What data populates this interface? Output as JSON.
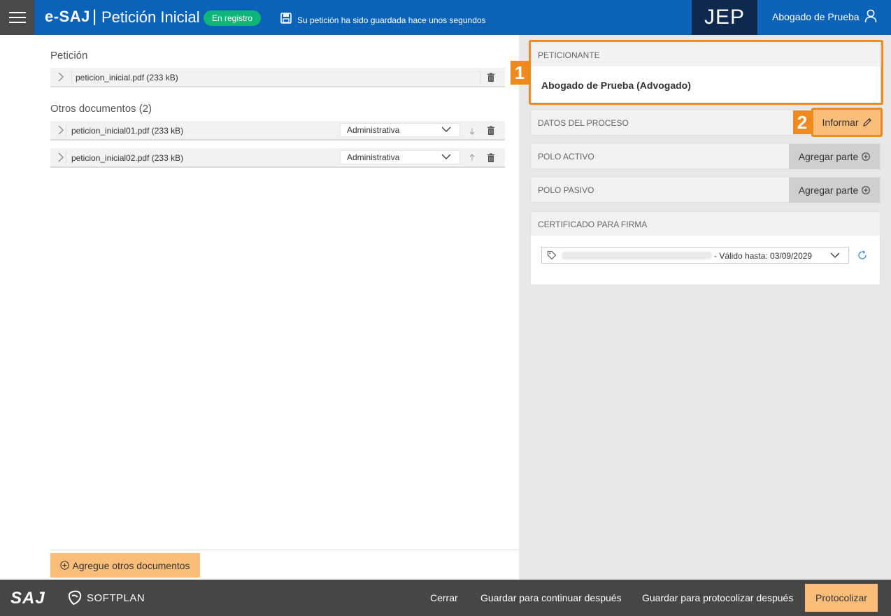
{
  "header": {
    "logo": "e-SAJ",
    "separator": "|",
    "title": "Petición Inicial",
    "status_badge": "En registro",
    "save_message": "Su petición ha sido guardada hace unos segundos",
    "court": "JEP",
    "user_name": "Abogado de Prueba",
    "colors": {
      "header_bg": "#0a63b8",
      "badge": "#10b578",
      "court_bg": "#0d2a4e"
    }
  },
  "left": {
    "peticion_label": "Petición",
    "main_doc": {
      "name": "peticion_inicial.pdf (233 kB)"
    },
    "otros_label": "Otros documentos (2)",
    "other_docs": [
      {
        "name": "peticion_inicial01.pdf (233 kB)",
        "type": "Administrativa",
        "move_icon": "arrow-down-icon"
      },
      {
        "name": "peticion_inicial02.pdf (233 kB)",
        "type": "Administrativa",
        "move_icon": "arrow-up-icon"
      }
    ],
    "add_button": "Agregue otros documentos"
  },
  "right": {
    "peticionante": {
      "title": "PETICIONANTE",
      "value": "Abogado de Prueba (Advogado)"
    },
    "datos": {
      "title": "DATOS DEL PROCESO",
      "button": "Informar"
    },
    "polo_activo": {
      "title": "POLO ACTIVO",
      "button": "Agregar parte"
    },
    "polo_pasivo": {
      "title": "POLO PASIVO",
      "button": "Agregar parte"
    },
    "certificado": {
      "title": "CERTIFICADO PARA FIRMA",
      "valid_text": "- Válido hasta: 03/09/2029"
    },
    "callouts": [
      "1",
      "2"
    ]
  },
  "footer": {
    "saj_logo": "SAJ",
    "softplan_logo": "SOFTPLAN",
    "cerrar": "Cerrar",
    "guardar_continuar": "Guardar para continuar después",
    "guardar_protocolizar": "Guardar para protocolizar después",
    "protocolizar": "Protocolizar",
    "colors": {
      "footer_bg": "#484545",
      "accent": "#fbbd7a",
      "highlight": "#f08a1c"
    }
  }
}
